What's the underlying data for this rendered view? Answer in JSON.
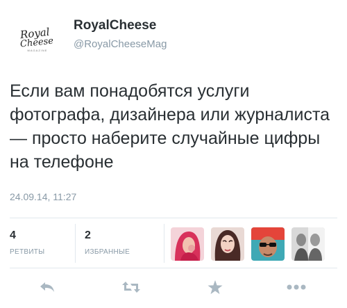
{
  "account": {
    "logo_line1": "Royal",
    "logo_line2": "Cheese",
    "logo_small": "MAGAZINE",
    "name": "RoyalCheese",
    "handle": "@RoyalCheeseMag"
  },
  "tweet": {
    "text": "Если вам понадобятся услуги фотографа, дизайнера или журналиста — просто наберите случайные цифры на телефоне",
    "date": "24.09.14, 11:27"
  },
  "stats": {
    "retweets_count": "4",
    "retweets_label": "РЕТВИТЫ",
    "favorites_count": "2",
    "favorites_label": "ИЗБРАННЫЕ"
  },
  "favoriters": [
    {
      "icon": "avatar-red-hair"
    },
    {
      "icon": "avatar-dark-hair"
    },
    {
      "icon": "avatar-sunglasses"
    },
    {
      "icon": "avatar-mirror-selfie"
    }
  ],
  "actions": [
    {
      "icon": "reply-icon"
    },
    {
      "icon": "retweet-icon"
    },
    {
      "icon": "favorite-icon"
    },
    {
      "icon": "more-icon"
    }
  ],
  "colors": {
    "text": "#292f33",
    "secondary": "#8899a6",
    "divider": "#e1e8ed",
    "icon": "#aab8c2"
  }
}
